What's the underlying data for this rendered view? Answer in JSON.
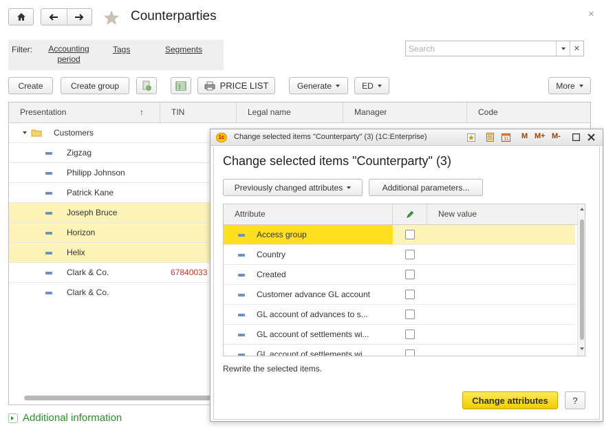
{
  "window": {
    "title": "Counterparties",
    "close_glyph": "×"
  },
  "filter": {
    "label": "Filter:",
    "links": [
      "Accounting",
      "period",
      "Tags",
      "Segments"
    ]
  },
  "search": {
    "placeholder": "Search"
  },
  "toolbar": {
    "create": "Create",
    "create_group": "Create group",
    "price_list": "PRICE LIST",
    "generate": "Generate",
    "ed": "ED",
    "more": "More"
  },
  "table": {
    "columns": [
      "Presentation",
      "TIN",
      "Legal name",
      "Manager",
      "Code"
    ],
    "sort_glyph": "↑",
    "group": "Customers",
    "rows": [
      {
        "name": "Zigzag",
        "tin": "",
        "selected": false
      },
      {
        "name": "Philipp Johnson",
        "tin": "",
        "selected": false
      },
      {
        "name": "Patrick Kane",
        "tin": "",
        "selected": false
      },
      {
        "name": "Joseph Bruce",
        "tin": "",
        "selected": true
      },
      {
        "name": "Horizon",
        "tin": "",
        "selected": true
      },
      {
        "name": "Helix",
        "tin": "",
        "selected": true
      },
      {
        "name": "Clark & Co.",
        "tin": "67840033",
        "selected": false
      },
      {
        "name": "Clark & Co.",
        "tin": "",
        "selected": false
      }
    ]
  },
  "footer": {
    "additional_info": "Additional information"
  },
  "dialog": {
    "titlebar": "Change selected items \"Counterparty\" (3)  (1C:Enterprise)",
    "logo": "1c",
    "tool_icons": [
      "M",
      "M+",
      "M-"
    ],
    "heading": "Change selected items \"Counterparty\" (3)",
    "prev_changed": "Previously changed attributes",
    "additional_params": "Additional parameters...",
    "grid": {
      "col_attribute": "Attribute",
      "col_new_value": "New value",
      "rows": [
        "Access group",
        "Country",
        "Created",
        "Customer advance GL account",
        "GL account of advances to s...",
        "GL account of settlements wi...",
        "GL account of settlements wi..."
      ]
    },
    "rewrite_text": "Rewrite the selected items.",
    "change_button": "Change attributes",
    "help_button": "?"
  },
  "colors": {
    "selection": "#fbf3b8",
    "active_cell": "#ffdf1e",
    "primary_button": "#f2cc00",
    "tin_text": "#c0392b",
    "link_green": "#2e8b2e"
  }
}
